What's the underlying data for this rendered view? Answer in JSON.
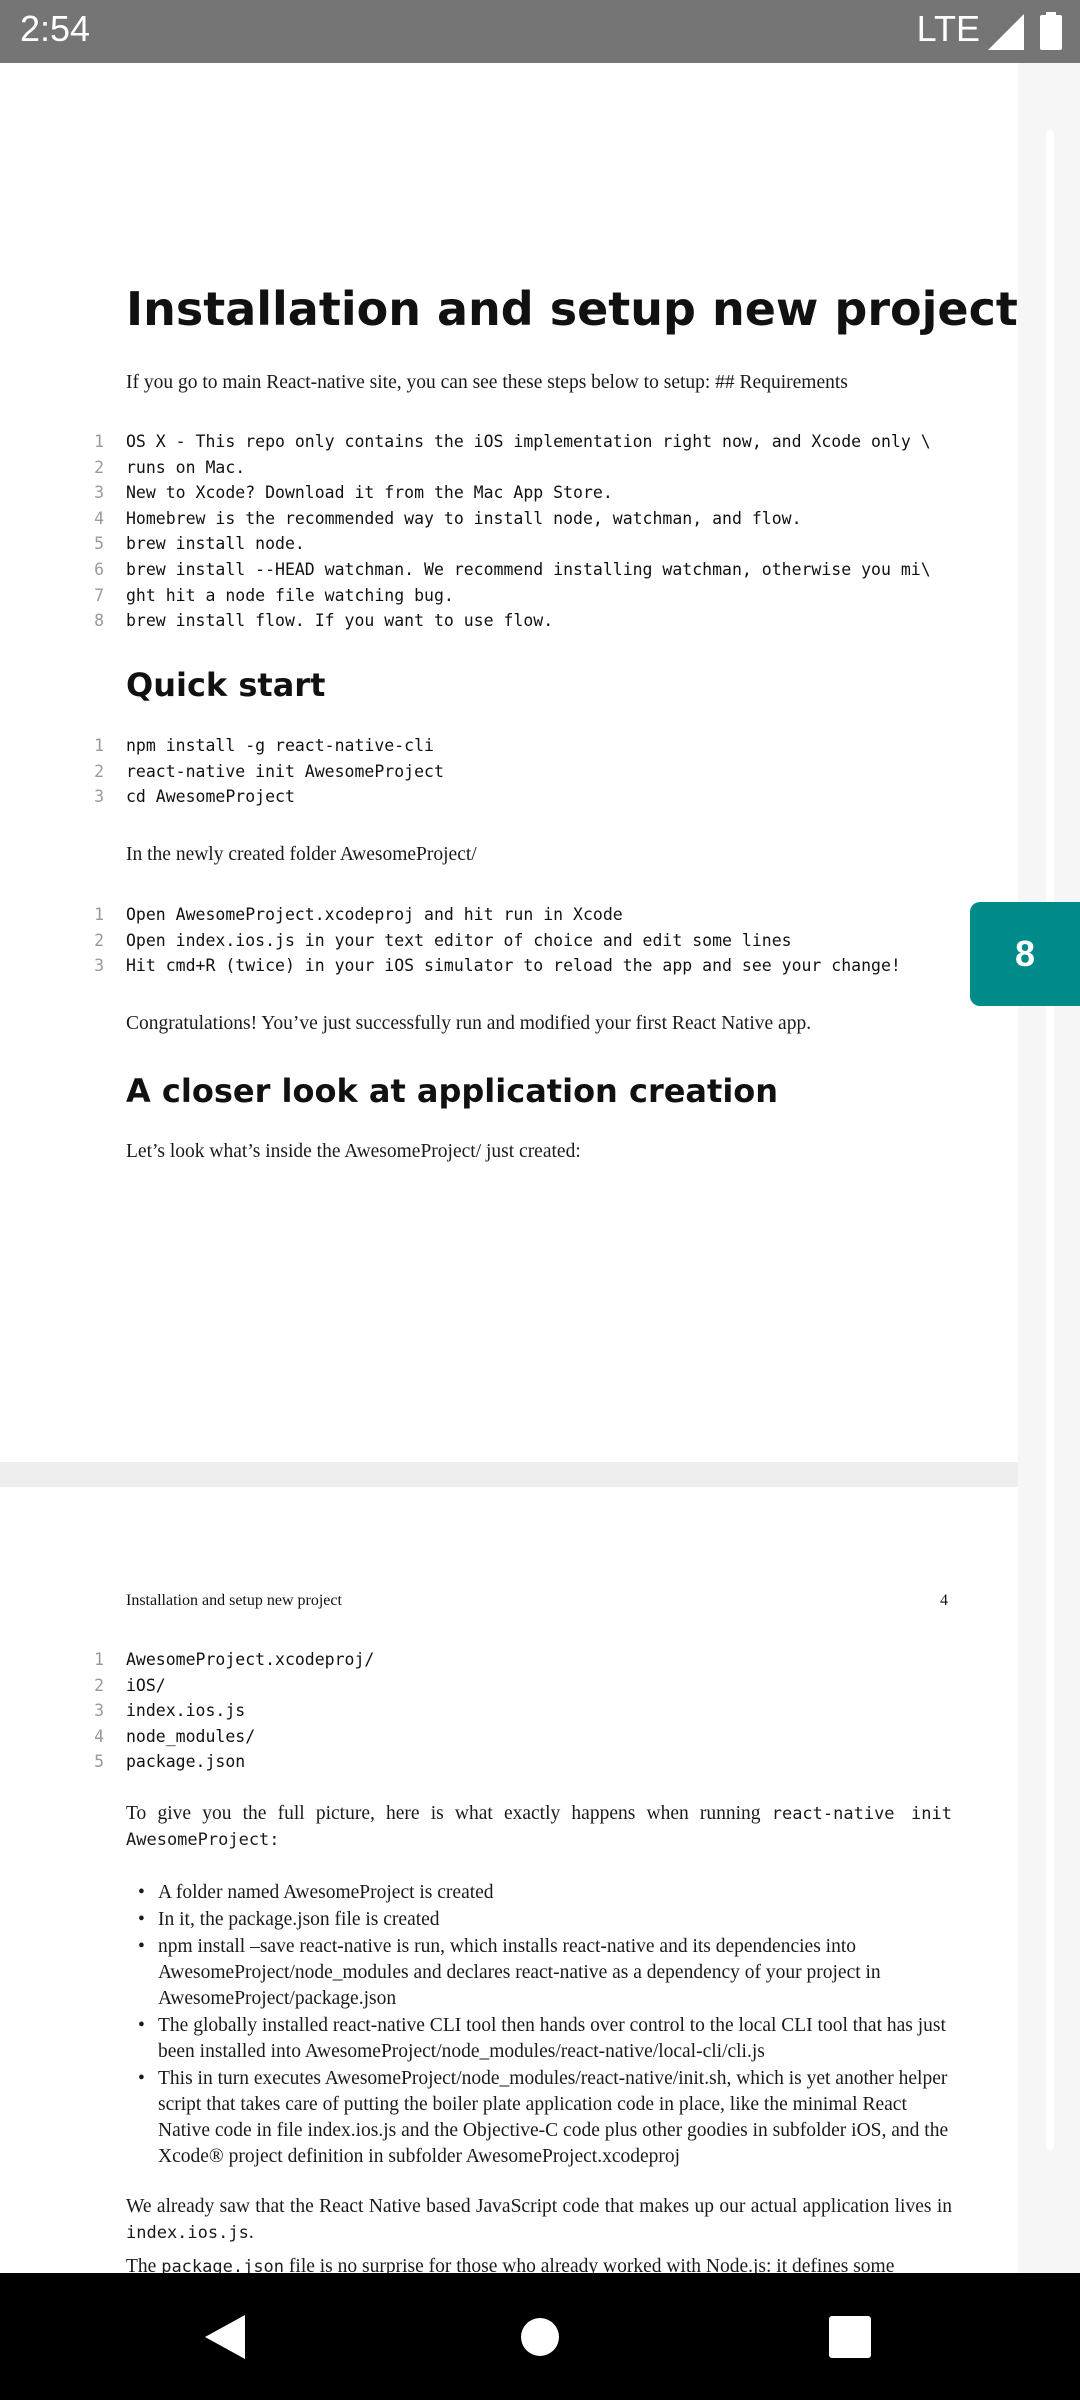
{
  "status_bar": {
    "time": "2:54",
    "network": "LTE"
  },
  "page1": {
    "title": "Installation and setup new project",
    "intro": "If you go to main React-native site, you can see these steps below to setup: ## Requirements",
    "requirements_code": [
      {
        "n": "1",
        "text": "OS X - This repo only contains the iOS implementation right now, and Xcode only \\"
      },
      {
        "n": "2",
        "text": "runs on Mac."
      },
      {
        "n": "3",
        "text": "New to Xcode? Download it from the Mac App Store."
      },
      {
        "n": "4",
        "text": "Homebrew is the recommended way to install node, watchman, and flow."
      },
      {
        "n": "5",
        "text": "brew install node."
      },
      {
        "n": "6",
        "text": "brew install --HEAD watchman. We recommend installing watchman, otherwise you mi\\"
      },
      {
        "n": "7",
        "text": "ght hit a node file watching bug."
      },
      {
        "n": "8",
        "text": "brew install flow. If you want to use flow."
      }
    ],
    "quick_start_heading": "Quick start",
    "quick_start_code": [
      {
        "n": "1",
        "text": "npm install -g react-native-cli"
      },
      {
        "n": "2",
        "text": "react-native init AwesomeProject"
      },
      {
        "n": "3",
        "text": "cd AwesomeProject"
      }
    ],
    "folder_text": "In the newly created folder AwesomeProject/",
    "folder_code": [
      {
        "n": "1",
        "text": "Open AwesomeProject.xcodeproj and hit run in Xcode"
      },
      {
        "n": "2",
        "text": "Open index.ios.js in your text editor of choice and edit some lines"
      },
      {
        "n": "3",
        "text": "Hit cmd+R (twice) in your iOS simulator to reload the app and see your change!"
      }
    ],
    "congrats": "Congratulations! You’ve just successfully run and modified your first React Native app.",
    "closer_heading": "A closer look at application creation",
    "closer_text": "Let’s look what’s inside the AwesomeProject/ just created:"
  },
  "page_badge": "8",
  "page2": {
    "running_head": "Installation and setup new project",
    "page_number": "4",
    "files_code": [
      {
        "n": "1",
        "text": "AwesomeProject.xcodeproj/"
      },
      {
        "n": "2",
        "text": "iOS/"
      },
      {
        "n": "3",
        "text": "index.ios.js"
      },
      {
        "n": "4",
        "text": "node_modules/"
      },
      {
        "n": "5",
        "text": "package.json"
      }
    ],
    "full_picture_text": "To give you the full picture, here is what exactly happens when running",
    "full_picture_code": "react-native init AwesomeProject:",
    "bullets": [
      "A folder named AwesomeProject is created",
      "In it, the package.json file is created",
      "npm install –save react-native is run, which installs react-native and its dependencies into AwesomeProject/node_modules and declares react-native as a dependency of your project in AwesomeProject/package.json",
      "The globally installed react-native CLI tool then hands over control to the local CLI tool that has just been installed into AwesomeProject/node_modules/react-native/local-cli/cli.js",
      "This in turn executes AwesomeProject/node_modules/react-native/init.sh, which is yet another helper script that takes care of putting the boiler plate application code in place, like the minimal React Native code in file index.ios.js and the Objective-C code plus other goodies in subfolder iOS, and the Xcode® project definition in subfolder AwesomeProject.xcodeproj"
    ],
    "already_saw_text": "We already saw that the React Native based JavaScript code that makes up our actual application lives in",
    "already_saw_code": "index.ios.js",
    "package_text_a": "The",
    "package_code": "package.json",
    "package_text_b": "file is no surprise for those who already worked with Node.js: it defines some"
  }
}
